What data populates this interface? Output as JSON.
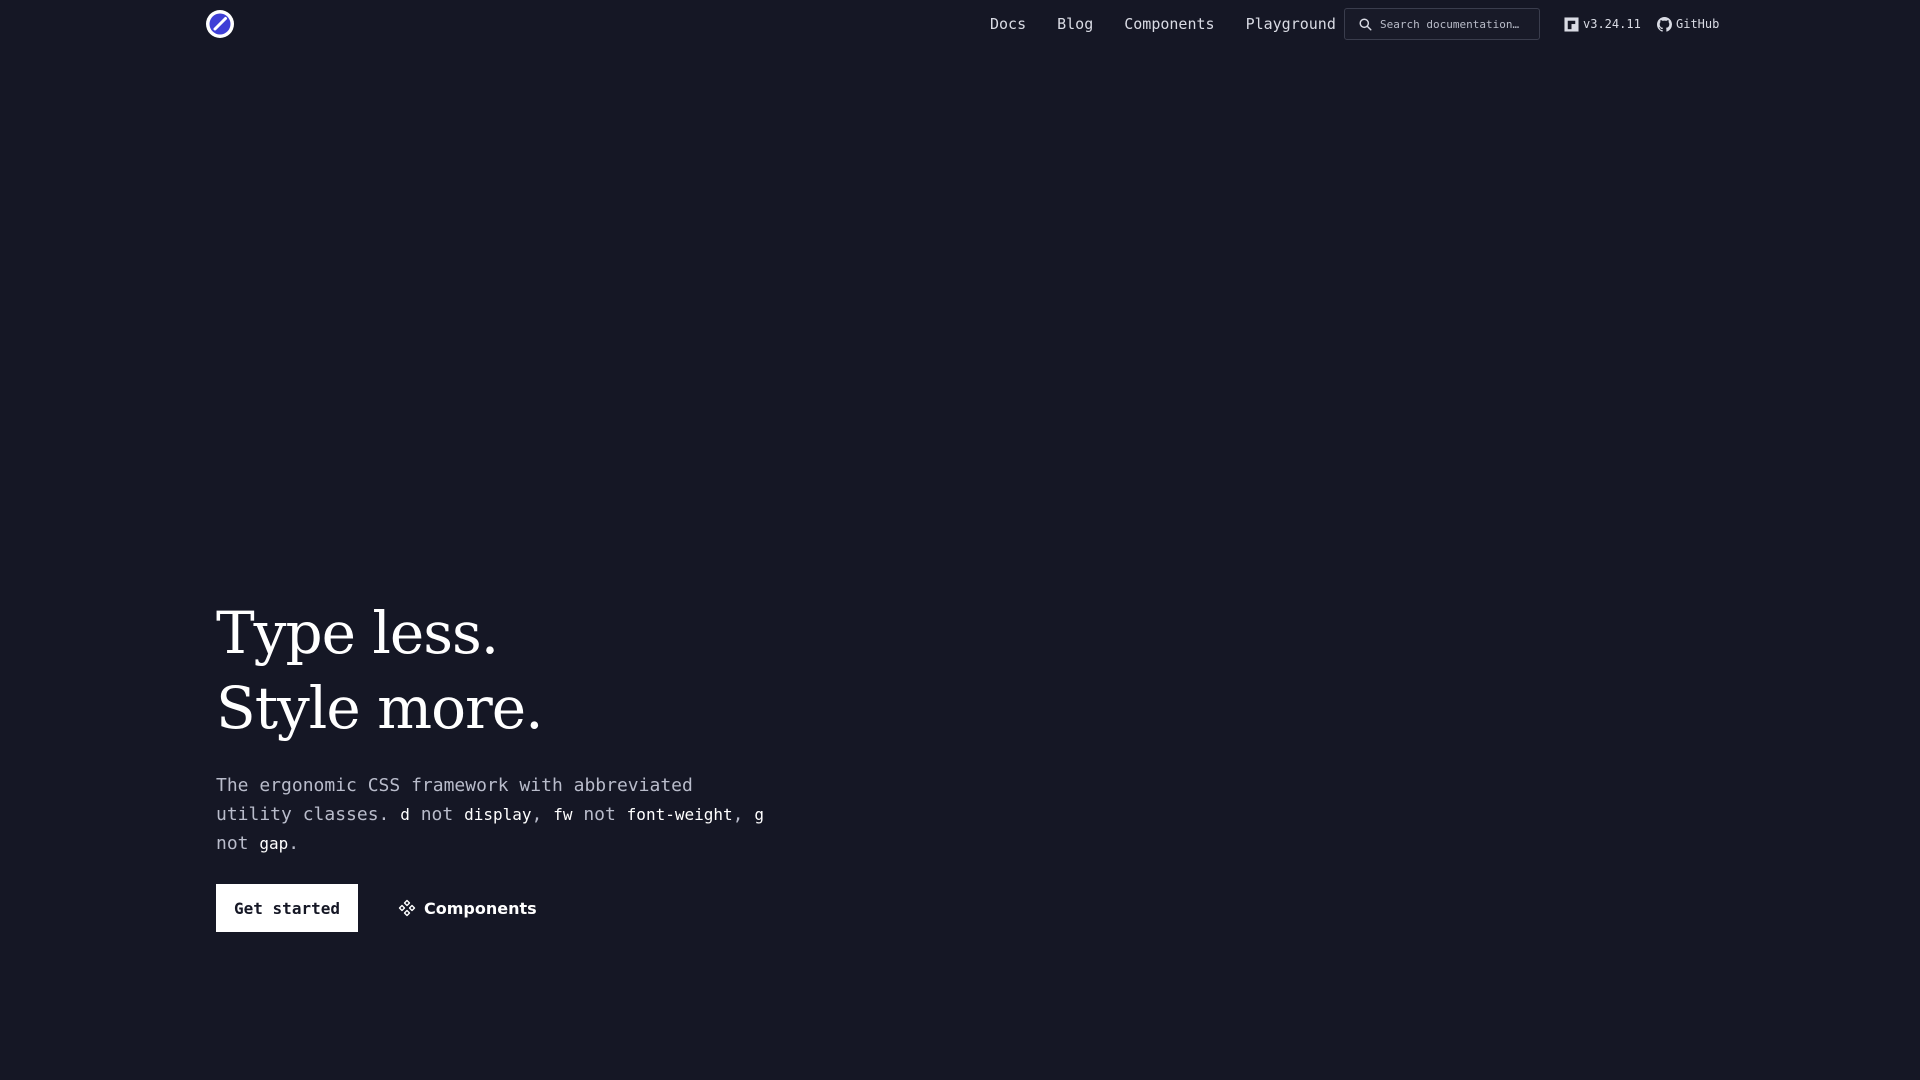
{
  "header": {
    "logo_alt": "logo",
    "nav": {
      "docs": "Docs",
      "blog": "Blog",
      "components": "Components",
      "playground": "Playground"
    },
    "search": {
      "placeholder": "Search documentation…",
      "icon": "search-icon"
    },
    "version": {
      "label": "v3.24.11",
      "icon": "npm-icon"
    },
    "github": {
      "label": "GitHub",
      "icon": "github-icon"
    }
  },
  "hero": {
    "title_line1": "Type less.",
    "title_line2": "Style more.",
    "description": {
      "part1": "The ergonomic CSS framework with abbreviated utility classes.",
      "c1": "d",
      "not1": "not",
      "c2": "display",
      "sep1": ",",
      "c3": "fw",
      "not2": "not",
      "c4": "font-weight",
      "sep2": ",",
      "c5": "g",
      "not3": "not",
      "c6": "gap",
      "end": "."
    },
    "primary_button": "Get started",
    "secondary_button": "Components",
    "secondary_icon": "component-icon"
  },
  "colors": {
    "background": "#151725",
    "text": "#ffffff",
    "muted": "#b9bccb",
    "logo_accent": "#3f3fd6"
  }
}
